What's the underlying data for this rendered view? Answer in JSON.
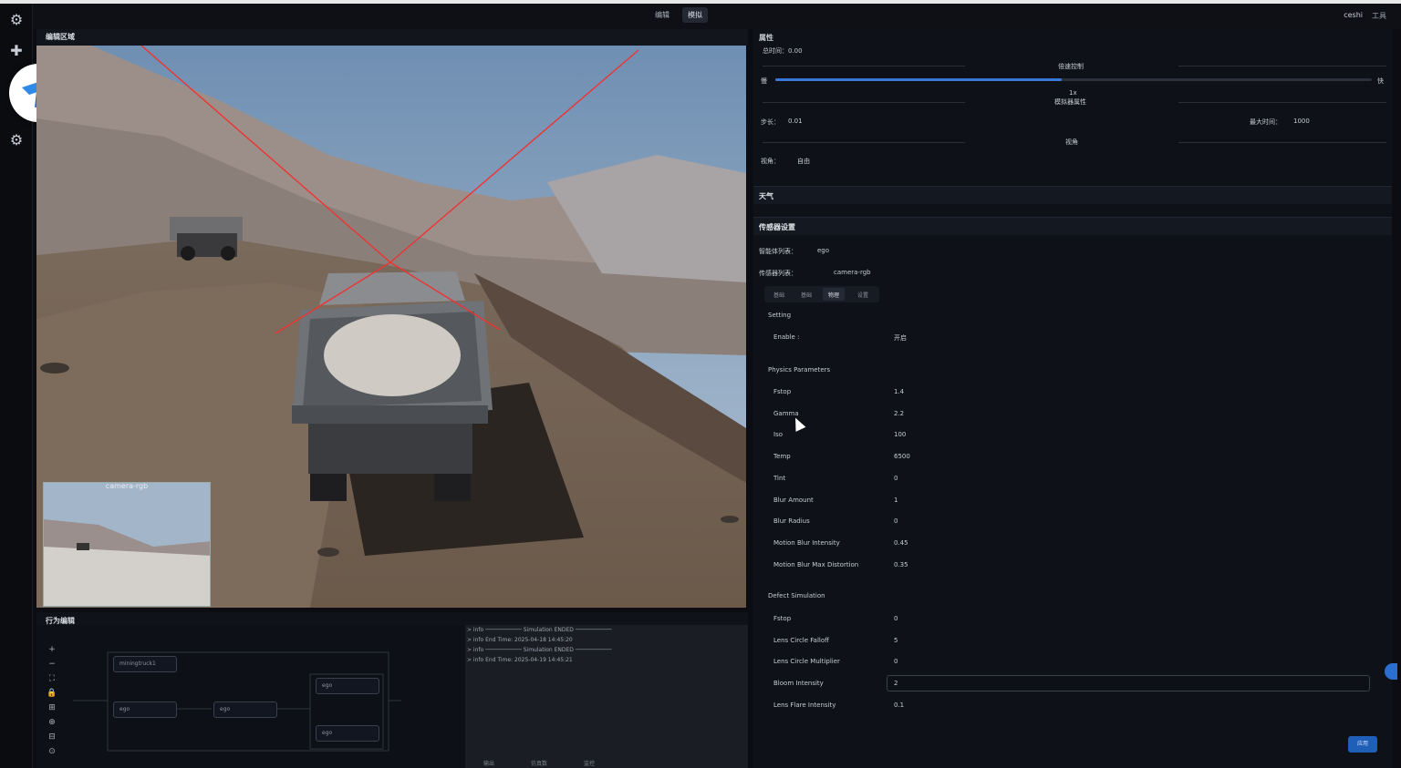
{
  "topbar": {
    "tab_edit": "编辑",
    "tab_sim": "模拟",
    "user": "ceshi",
    "tools": "工具"
  },
  "editor": {
    "title": "编辑区域",
    "thumb_label": "camera-rgb"
  },
  "behavior": {
    "title": "行为编辑",
    "nodes": [
      "miningtruck1",
      "ego",
      "ego",
      "ego",
      "ego"
    ],
    "tools": [
      "+",
      "−",
      "⛶",
      "🔒",
      "⊞",
      "⊕",
      "⊟",
      "⊙"
    ]
  },
  "log": {
    "lines": [
      "> info  ─────────── Simulation ENDED ───────────",
      "> info  End Time: 2025-04-18 14:45:20",
      "> info  ─────────── Simulation ENDED ───────────",
      "> info  End Time: 2025-04-19 14:45:21"
    ],
    "tabs": [
      "输出",
      "仿真数",
      "监控"
    ]
  },
  "properties": {
    "title": "属性",
    "sim_time": "总时间：0.00",
    "speed_label": "倍速控制",
    "slow": "慢",
    "fast": "快",
    "speed_value": "1x",
    "speed_fraction": 0.48,
    "sim_props": "模拟器属性",
    "step_label": "步长：",
    "step_value": "0.01",
    "max_time_label": "最大时间：",
    "max_time_value": "1000",
    "view_header": "视角",
    "view_label": "视角：",
    "view_value": "自由"
  },
  "weather": {
    "title": "天气"
  },
  "sensor": {
    "title": "传感器设置",
    "agent_label": "智能体列表：",
    "agent_value": "ego",
    "sensor_label": "传感器列表：",
    "sensor_value": "camera-rgb",
    "subtabs": [
      "基础",
      "基础",
      "物理",
      "设置"
    ],
    "setting_header": "Setting",
    "enable_label": "Enable :",
    "enable_value": "开启",
    "physics_header": "Physics Parameters",
    "physics": [
      {
        "label": "Fstop",
        "value": "1.4"
      },
      {
        "label": "Gamma",
        "value": "2.2"
      },
      {
        "label": "Iso",
        "value": "100"
      },
      {
        "label": "Temp",
        "value": "6500"
      },
      {
        "label": "Tint",
        "value": "0"
      },
      {
        "label": "Blur Amount",
        "value": "1"
      },
      {
        "label": "Blur Radius",
        "value": "0"
      },
      {
        "label": "Motion Blur Intensity",
        "value": "0.45"
      },
      {
        "label": "Motion Blur Max Distortion",
        "value": "0.35"
      }
    ],
    "defect_header": "Defect Simulation",
    "defect": [
      {
        "label": "Fstop",
        "value": "0"
      },
      {
        "label": "Lens Circle Falloff",
        "value": "5"
      },
      {
        "label": "Lens Circle Multiplier",
        "value": "0"
      },
      {
        "label": "Bloom Intensity",
        "value": "2"
      },
      {
        "label": "Lens Flare Intensity",
        "value": "0.1"
      }
    ],
    "apply": "应用"
  }
}
